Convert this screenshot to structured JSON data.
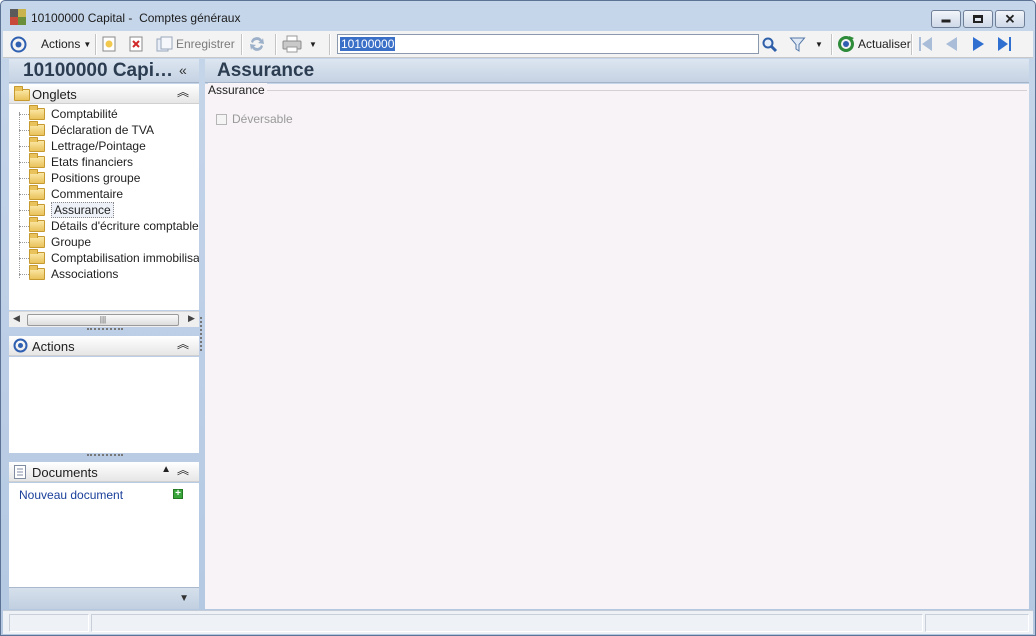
{
  "window": {
    "title": "10100000 Capital -  Comptes généraux"
  },
  "toolbar": {
    "actions_label": "Actions",
    "save_label": "Enregistrer",
    "search_value": "10100000",
    "refresh_label": "Actualiser"
  },
  "left": {
    "title": "10100000 Capi…",
    "collapse_glyph": "«",
    "tabs_section": {
      "label": "Onglets",
      "items": [
        {
          "label": "Comptabilité"
        },
        {
          "label": "Déclaration de TVA"
        },
        {
          "label": "Lettrage/Pointage"
        },
        {
          "label": "Etats financiers"
        },
        {
          "label": "Positions groupe"
        },
        {
          "label": "Commentaire"
        },
        {
          "label": "Assurance",
          "selected": true
        },
        {
          "label": "Détails d'écriture comptable"
        },
        {
          "label": "Groupe"
        },
        {
          "label": "Comptabilisation immobilisations"
        },
        {
          "label": "Associations"
        }
      ]
    },
    "actions_section": {
      "label": "Actions"
    },
    "documents_section": {
      "label": "Documents",
      "new_document": "Nouveau document"
    }
  },
  "main": {
    "title": "Assurance",
    "group_label": "Assurance",
    "checkbox_label": "Déversable",
    "checkbox_checked": false
  },
  "colors": {
    "header_gradient": [
      "#dde6f1",
      "#c5d2e3"
    ],
    "header_text": "#2c3d52",
    "link": "#1a3f9a",
    "selection": "#3a6fc8",
    "nav_arrow": "#2f6fd0"
  }
}
